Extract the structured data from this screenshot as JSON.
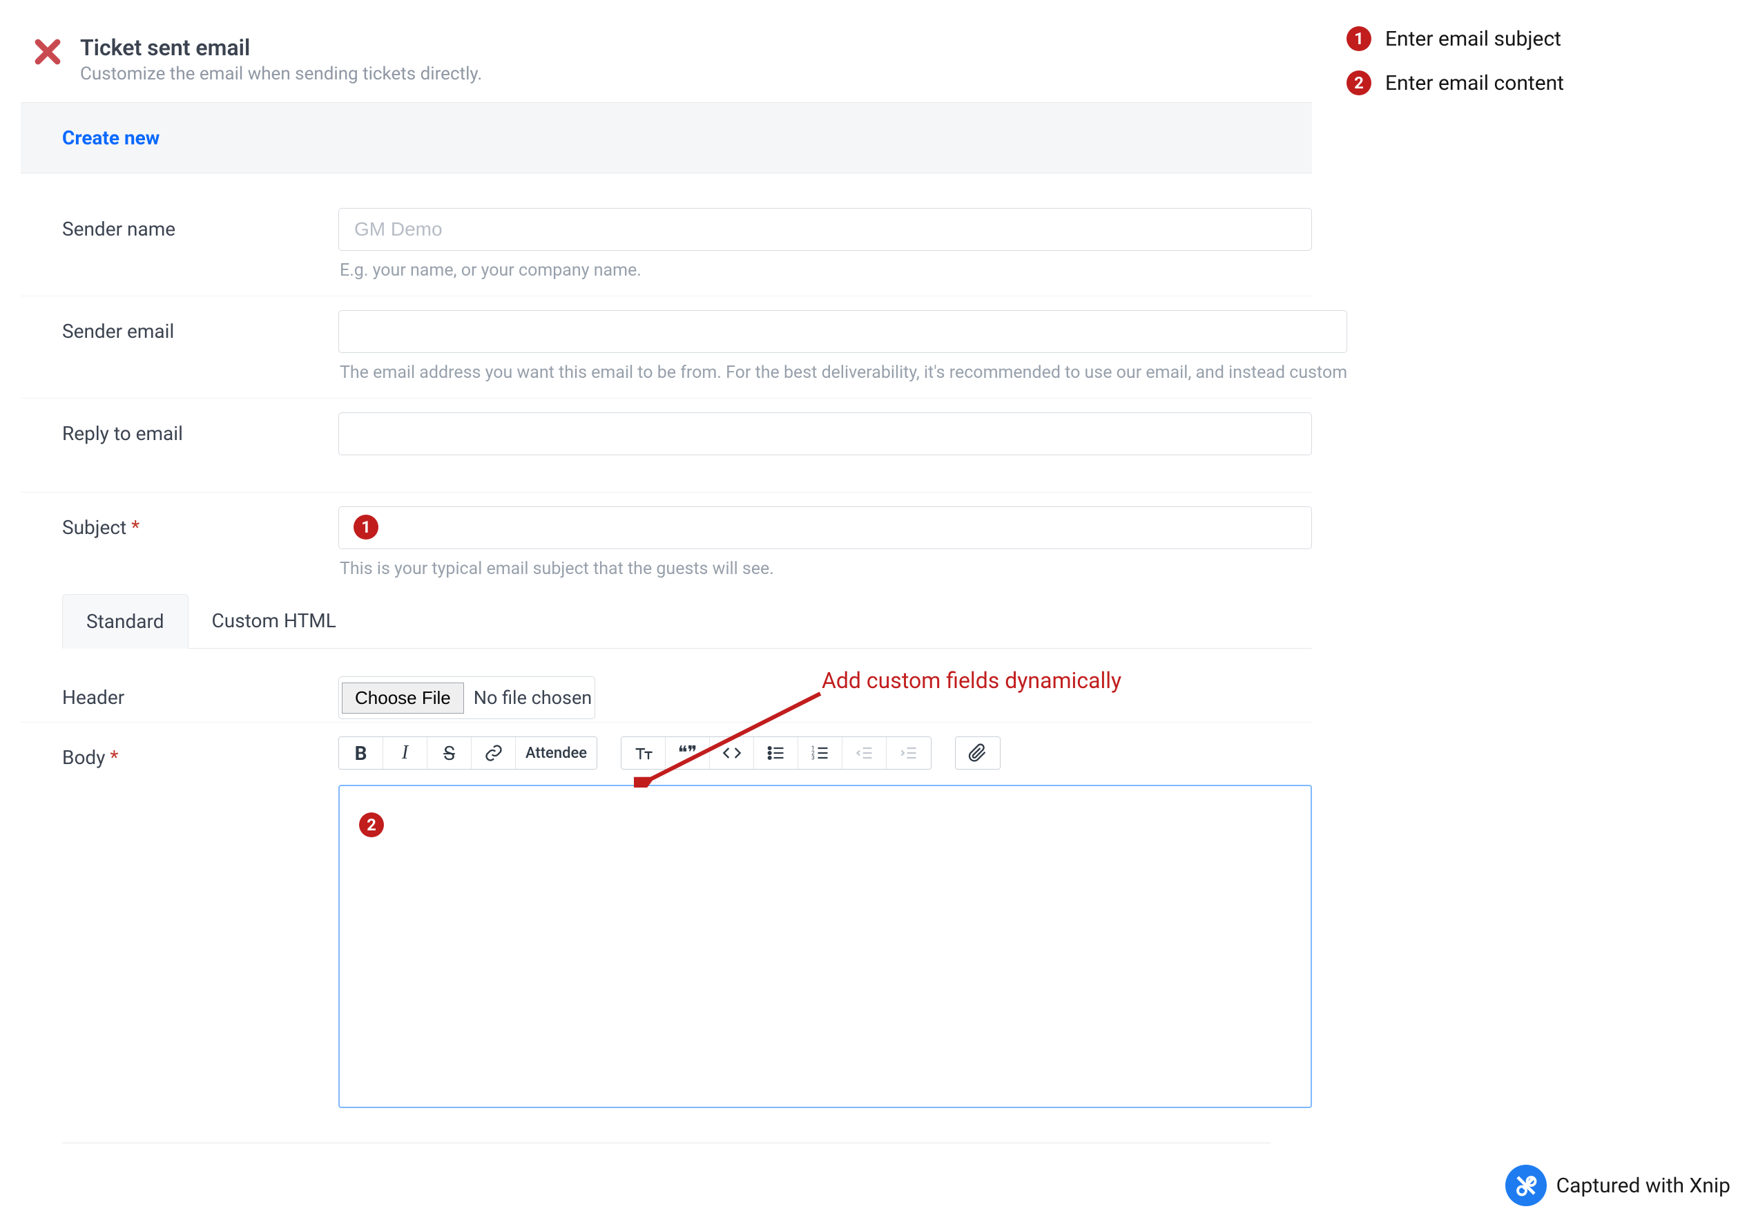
{
  "header": {
    "title": "Ticket sent email",
    "subtitle": "Customize the email when sending tickets directly."
  },
  "topTabs": {
    "active": "Create new"
  },
  "fields": {
    "senderName": {
      "label": "Sender name",
      "placeholder": "GM Demo",
      "value": "",
      "help": "E.g. your name, or your company name."
    },
    "senderEmail": {
      "label": "Sender email",
      "value": "",
      "help": "The email address you want this email to be from. For the best deliverability, it's recommended to use our email, and instead custom"
    },
    "replyTo": {
      "label": "Reply to email",
      "value": ""
    },
    "subject": {
      "label": "Subject",
      "required": "*",
      "value": "",
      "help": "This is your typical email subject that the guests will see."
    },
    "header": {
      "label": "Header",
      "chooseFile": "Choose File",
      "fileStatus": "No file chosen"
    },
    "body": {
      "label": "Body",
      "required": "*"
    }
  },
  "subTabs": {
    "standard": "Standard",
    "custom": "Custom HTML"
  },
  "toolbar": {
    "attendee": "Attendee"
  },
  "annotation": {
    "badge1": "1",
    "badge2": "2",
    "note1": "Enter email subject",
    "note2": "Enter email content",
    "callout": "Add custom fields dynamically"
  },
  "watermark": {
    "text": "Captured with Xnip"
  }
}
